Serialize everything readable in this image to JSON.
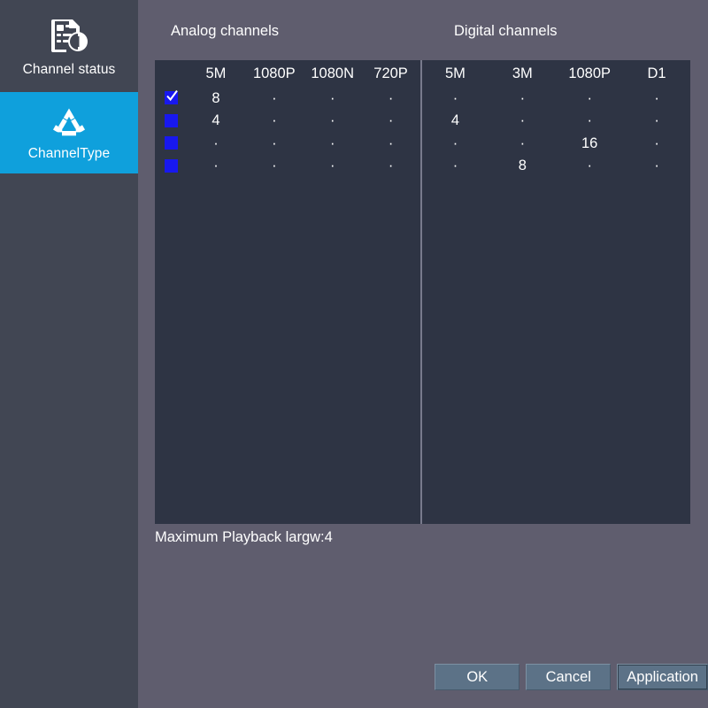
{
  "sidebar": {
    "items": [
      {
        "id": "channel-status",
        "label": "Channel status",
        "icon": "report-document-icon",
        "active": false
      },
      {
        "id": "channel-type",
        "label": "ChannelType",
        "icon": "recycle-icon",
        "active": true
      }
    ]
  },
  "main": {
    "analog": {
      "title": "Analog channels",
      "columns": [
        "5M",
        "1080P",
        "1080N",
        "720P"
      ],
      "rows": [
        {
          "checked": true,
          "values": [
            "8",
            "·",
            "·",
            "·"
          ]
        },
        {
          "checked": false,
          "values": [
            "4",
            "·",
            "·",
            "·"
          ]
        },
        {
          "checked": false,
          "values": [
            "·",
            "·",
            "·",
            "·"
          ]
        },
        {
          "checked": false,
          "values": [
            "·",
            "·",
            "·",
            "·"
          ]
        }
      ]
    },
    "digital": {
      "title": "Digital channels",
      "columns": [
        "5M",
        "3M",
        "1080P",
        "D1"
      ],
      "rows": [
        {
          "values": [
            "·",
            "·",
            "·",
            "·"
          ]
        },
        {
          "values": [
            "4",
            "·",
            "·",
            "·"
          ]
        },
        {
          "values": [
            "·",
            "·",
            "16",
            "·"
          ]
        },
        {
          "values": [
            "·",
            "8",
            "·",
            "·"
          ]
        }
      ]
    },
    "status_text": "Maximum Playback largw:4"
  },
  "buttons": {
    "ok": "OK",
    "cancel": "Cancel",
    "application": "Application"
  },
  "colors": {
    "accent": "#0fa0dc",
    "sidebar_bg": "#414653",
    "dialog_bg": "#5f5d6e",
    "panel_bg": "#2e3444",
    "checkbox": "#1818ef",
    "button_bg": "#5c7287"
  }
}
